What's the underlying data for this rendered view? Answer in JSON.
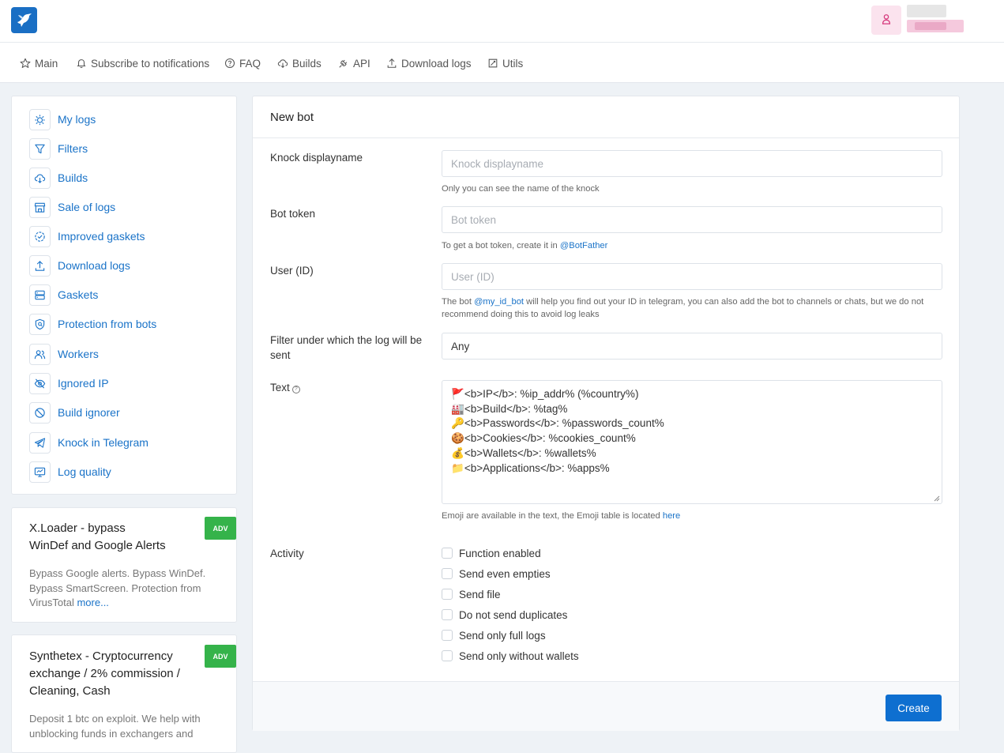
{
  "brand": {
    "logo_icon": "hummingbird-icon",
    "accent": "#1a6fc4"
  },
  "user": {
    "avatar_icon": "user-icon"
  },
  "nav": [
    {
      "label": "Main",
      "icon": "star-icon"
    },
    {
      "label": "Subscribe to notifications",
      "icon": "bell-icon"
    },
    {
      "label": "FAQ",
      "icon": "question-icon"
    },
    {
      "label": "Builds",
      "icon": "cloud-download-icon"
    },
    {
      "label": "API",
      "icon": "plug-icon"
    },
    {
      "label": "Download logs",
      "icon": "upload-icon"
    },
    {
      "label": "Utils",
      "icon": "tool-icon"
    }
  ],
  "sidebar": {
    "items": [
      {
        "label": "My logs",
        "icon": "bug-icon"
      },
      {
        "label": "Filters",
        "icon": "filter-icon"
      },
      {
        "label": "Builds",
        "icon": "cloud-download-icon"
      },
      {
        "label": "Sale of logs",
        "icon": "store-icon"
      },
      {
        "label": "Improved gaskets",
        "icon": "badge-check-icon"
      },
      {
        "label": "Download logs",
        "icon": "upload-icon"
      },
      {
        "label": "Gaskets",
        "icon": "server-icon"
      },
      {
        "label": "Protection from bots",
        "icon": "shield-search-icon"
      },
      {
        "label": "Workers",
        "icon": "users-icon"
      },
      {
        "label": "Ignored IP",
        "icon": "eye-off-icon"
      },
      {
        "label": "Build ignorer",
        "icon": "ban-icon"
      },
      {
        "label": "Knock in Telegram",
        "icon": "telegram-icon"
      },
      {
        "label": "Log quality",
        "icon": "monitor-icon"
      }
    ]
  },
  "ads": [
    {
      "title_line1": "X.Loader - bypass",
      "title_line2": "WinDef and Google Alerts",
      "desc_line1": "Bypass Google alerts. Bypass WinDef.",
      "desc_line2": "Bypass SmartScreen. Protection from",
      "desc_line3": "VirusTotal",
      "more": "more...",
      "badge": "ADV"
    },
    {
      "title_line1": "Synthetex - Cryptocurrency",
      "title_line2": "exchange / 2% commission /",
      "title_line3": "Cleaning, Cash",
      "desc_line1": "Deposit 1 btc on exploit. We help with",
      "desc_line2": "unblocking funds in exchangers and",
      "badge": "ADV"
    }
  ],
  "form": {
    "title": "New bot",
    "knock_label": "Knock displayname",
    "knock_placeholder": "Knock displayname",
    "knock_hint": "Only you can see the name of the knock",
    "token_label": "Bot token",
    "token_placeholder": "Bot token",
    "token_hint_prefix": "To get a bot token, create it in",
    "token_hint_link": "@BotFather",
    "user_label": "User (ID)",
    "user_placeholder": "User (ID)",
    "user_hint_prefix": "The bot",
    "user_hint_link": "@my_id_bot",
    "user_hint_line1_rest": "will help you find out your ID in telegram, you can also add the bot to channels or chats, but we do not",
    "user_hint_line2": "recommend doing this to avoid log leaks",
    "filter_label_line1": "Filter under which the log will be",
    "filter_label_line2": "sent",
    "filter_value": "Any",
    "text_label": "Text",
    "text_help": "?",
    "text_lines": [
      {
        "emoji": "🚩",
        "text": "<b>IP</b>: %ip_addr% (%country%)"
      },
      {
        "emoji": "🏭",
        "text": "<b>Build</b>: %tag%"
      },
      {
        "emoji": "🔑",
        "text": "<b>Passwords</b>: %passwords_count%"
      },
      {
        "emoji": "🍪",
        "text": "<b>Cookies</b>: %cookies_count%"
      },
      {
        "emoji": "💰",
        "text": "<b>Wallets</b>: %wallets%"
      },
      {
        "emoji": "📁",
        "text": "<b>Applications</b>: %apps%"
      }
    ],
    "emoji_hint_prefix": "Emoji are available in the text, the Emoji table is located",
    "emoji_hint_link": "here",
    "activity_label": "Activity",
    "checkboxes": [
      "Function enabled",
      "Send even empties",
      "Send file",
      "Do not send duplicates",
      "Send only full logs",
      "Send only without wallets"
    ],
    "submit": "Create"
  }
}
